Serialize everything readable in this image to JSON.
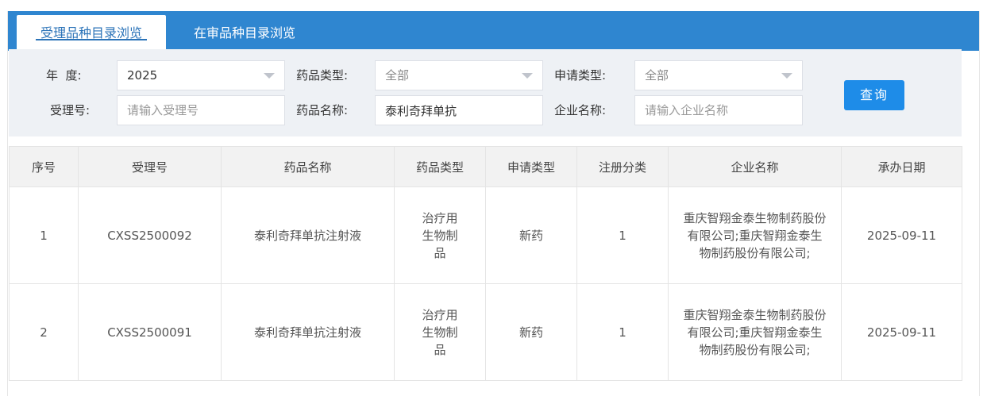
{
  "tabs": {
    "active": "受理品种目录浏览",
    "inactive": "在审品种目录浏览"
  },
  "filters": {
    "year_label": "年  度:",
    "year_value": "2025",
    "drug_type_label": "药品类型:",
    "drug_type_value": "全部",
    "apply_type_label": "申请类型:",
    "apply_type_value": "全部",
    "accept_no_label": "受理号:",
    "accept_no_placeholder": "请输入受理号",
    "drug_name_label": "药品名称:",
    "drug_name_value": "泰利奇拜单抗",
    "company_label": "企业名称:",
    "company_placeholder": "请输入企业名称",
    "query_button": "查询"
  },
  "table": {
    "headers": [
      "序号",
      "受理号",
      "药品名称",
      "药品类型",
      "申请类型",
      "注册分类",
      "企业名称",
      "承办日期"
    ],
    "rows": [
      {
        "index": "1",
        "accept_no": "CXSS2500092",
        "drug_name": "泰利奇拜单抗注射液",
        "drug_type": "治疗用生物制品",
        "apply_type": "新药",
        "reg_class": "1",
        "company": "重庆智翔金泰生物制药股份有限公司;重庆智翔金泰生物制药股份有限公司;",
        "date": "2025-09-11"
      },
      {
        "index": "2",
        "accept_no": "CXSS2500091",
        "drug_name": "泰利奇拜单抗注射液",
        "drug_type": "治疗用生物制品",
        "apply_type": "新药",
        "reg_class": "1",
        "company": "重庆智翔金泰生物制药股份有限公司;重庆智翔金泰生物制药股份有限公司;",
        "date": "2025-09-11"
      }
    ]
  }
}
